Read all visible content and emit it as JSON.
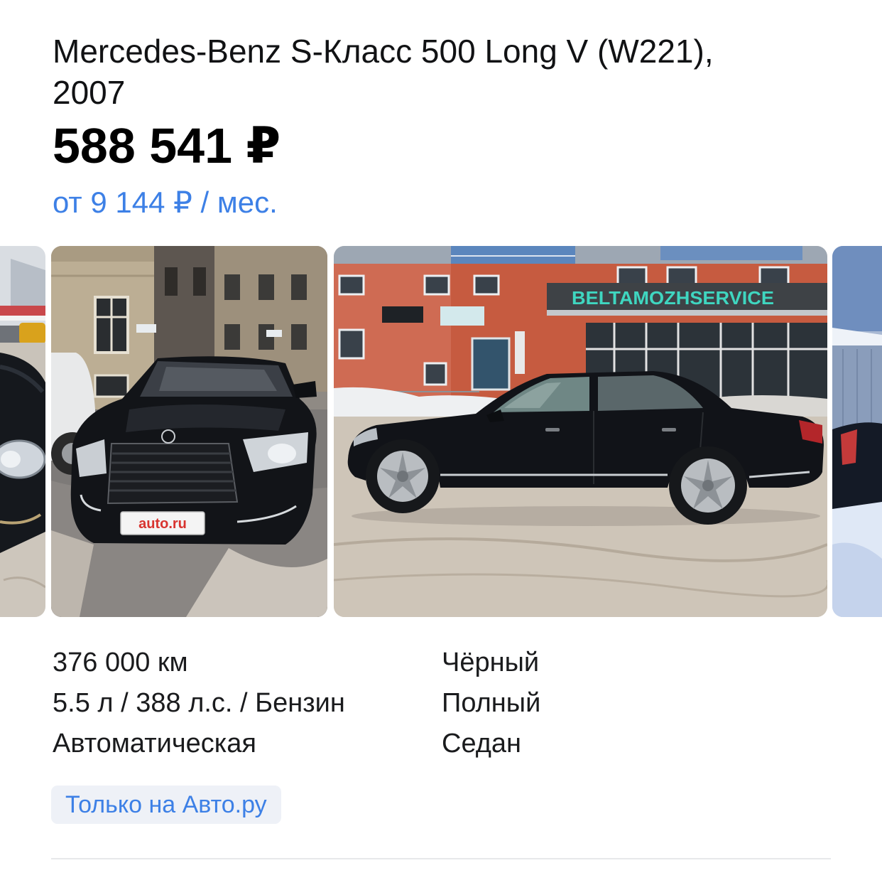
{
  "listing": {
    "title": "Mercedes-Benz S-Класс 500 Long V (W221), 2007",
    "price": "588 541 ₽",
    "monthly_payment": "от 9 144 ₽ / мес."
  },
  "gallery": {
    "photo_2": {
      "plate_text": "auto.ru"
    },
    "photo_3": {
      "sign_text": "BELTAMOZHSERVICE"
    }
  },
  "specs": {
    "mileage": "376 000 км",
    "engine": "5.5 л / 388 л.с. / Бензин",
    "transmission": "Автоматическая",
    "color": "Чёрный",
    "drive": "Полный",
    "body_type": "Седан"
  },
  "badge": {
    "label": "Только на Авто.ру"
  },
  "colors": {
    "accent": "#3d80e6",
    "badge_bg": "#eef1f7",
    "text": "#111214",
    "divider": "#e7e8ea"
  }
}
